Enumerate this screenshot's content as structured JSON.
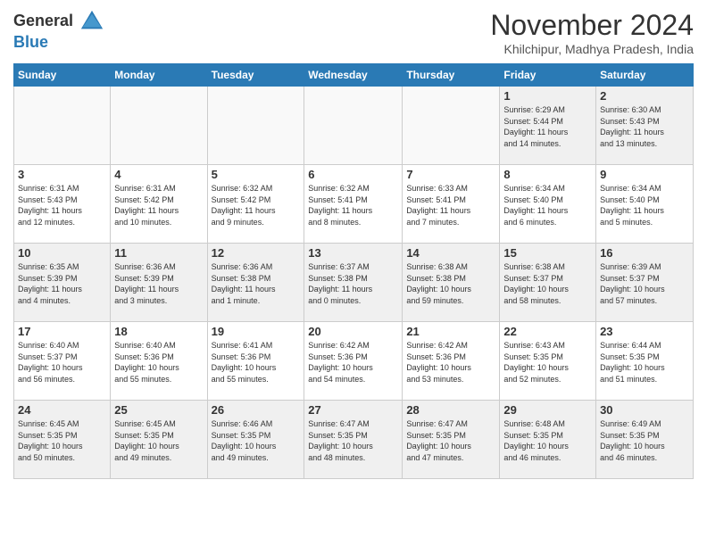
{
  "logo": {
    "general": "General",
    "blue": "Blue"
  },
  "header": {
    "month": "November 2024",
    "location": "Khilchipur, Madhya Pradesh, India"
  },
  "days_header": [
    "Sunday",
    "Monday",
    "Tuesday",
    "Wednesday",
    "Thursday",
    "Friday",
    "Saturday"
  ],
  "weeks": [
    [
      {
        "day": "",
        "info": ""
      },
      {
        "day": "",
        "info": ""
      },
      {
        "day": "",
        "info": ""
      },
      {
        "day": "",
        "info": ""
      },
      {
        "day": "",
        "info": ""
      },
      {
        "day": "1",
        "info": "Sunrise: 6:29 AM\nSunset: 5:44 PM\nDaylight: 11 hours\nand 14 minutes."
      },
      {
        "day": "2",
        "info": "Sunrise: 6:30 AM\nSunset: 5:43 PM\nDaylight: 11 hours\nand 13 minutes."
      }
    ],
    [
      {
        "day": "3",
        "info": "Sunrise: 6:31 AM\nSunset: 5:43 PM\nDaylight: 11 hours\nand 12 minutes."
      },
      {
        "day": "4",
        "info": "Sunrise: 6:31 AM\nSunset: 5:42 PM\nDaylight: 11 hours\nand 10 minutes."
      },
      {
        "day": "5",
        "info": "Sunrise: 6:32 AM\nSunset: 5:42 PM\nDaylight: 11 hours\nand 9 minutes."
      },
      {
        "day": "6",
        "info": "Sunrise: 6:32 AM\nSunset: 5:41 PM\nDaylight: 11 hours\nand 8 minutes."
      },
      {
        "day": "7",
        "info": "Sunrise: 6:33 AM\nSunset: 5:41 PM\nDaylight: 11 hours\nand 7 minutes."
      },
      {
        "day": "8",
        "info": "Sunrise: 6:34 AM\nSunset: 5:40 PM\nDaylight: 11 hours\nand 6 minutes."
      },
      {
        "day": "9",
        "info": "Sunrise: 6:34 AM\nSunset: 5:40 PM\nDaylight: 11 hours\nand 5 minutes."
      }
    ],
    [
      {
        "day": "10",
        "info": "Sunrise: 6:35 AM\nSunset: 5:39 PM\nDaylight: 11 hours\nand 4 minutes."
      },
      {
        "day": "11",
        "info": "Sunrise: 6:36 AM\nSunset: 5:39 PM\nDaylight: 11 hours\nand 3 minutes."
      },
      {
        "day": "12",
        "info": "Sunrise: 6:36 AM\nSunset: 5:38 PM\nDaylight: 11 hours\nand 1 minute."
      },
      {
        "day": "13",
        "info": "Sunrise: 6:37 AM\nSunset: 5:38 PM\nDaylight: 11 hours\nand 0 minutes."
      },
      {
        "day": "14",
        "info": "Sunrise: 6:38 AM\nSunset: 5:38 PM\nDaylight: 10 hours\nand 59 minutes."
      },
      {
        "day": "15",
        "info": "Sunrise: 6:38 AM\nSunset: 5:37 PM\nDaylight: 10 hours\nand 58 minutes."
      },
      {
        "day": "16",
        "info": "Sunrise: 6:39 AM\nSunset: 5:37 PM\nDaylight: 10 hours\nand 57 minutes."
      }
    ],
    [
      {
        "day": "17",
        "info": "Sunrise: 6:40 AM\nSunset: 5:37 PM\nDaylight: 10 hours\nand 56 minutes."
      },
      {
        "day": "18",
        "info": "Sunrise: 6:40 AM\nSunset: 5:36 PM\nDaylight: 10 hours\nand 55 minutes."
      },
      {
        "day": "19",
        "info": "Sunrise: 6:41 AM\nSunset: 5:36 PM\nDaylight: 10 hours\nand 55 minutes."
      },
      {
        "day": "20",
        "info": "Sunrise: 6:42 AM\nSunset: 5:36 PM\nDaylight: 10 hours\nand 54 minutes."
      },
      {
        "day": "21",
        "info": "Sunrise: 6:42 AM\nSunset: 5:36 PM\nDaylight: 10 hours\nand 53 minutes."
      },
      {
        "day": "22",
        "info": "Sunrise: 6:43 AM\nSunset: 5:35 PM\nDaylight: 10 hours\nand 52 minutes."
      },
      {
        "day": "23",
        "info": "Sunrise: 6:44 AM\nSunset: 5:35 PM\nDaylight: 10 hours\nand 51 minutes."
      }
    ],
    [
      {
        "day": "24",
        "info": "Sunrise: 6:45 AM\nSunset: 5:35 PM\nDaylight: 10 hours\nand 50 minutes."
      },
      {
        "day": "25",
        "info": "Sunrise: 6:45 AM\nSunset: 5:35 PM\nDaylight: 10 hours\nand 49 minutes."
      },
      {
        "day": "26",
        "info": "Sunrise: 6:46 AM\nSunset: 5:35 PM\nDaylight: 10 hours\nand 49 minutes."
      },
      {
        "day": "27",
        "info": "Sunrise: 6:47 AM\nSunset: 5:35 PM\nDaylight: 10 hours\nand 48 minutes."
      },
      {
        "day": "28",
        "info": "Sunrise: 6:47 AM\nSunset: 5:35 PM\nDaylight: 10 hours\nand 47 minutes."
      },
      {
        "day": "29",
        "info": "Sunrise: 6:48 AM\nSunset: 5:35 PM\nDaylight: 10 hours\nand 46 minutes."
      },
      {
        "day": "30",
        "info": "Sunrise: 6:49 AM\nSunset: 5:35 PM\nDaylight: 10 hours\nand 46 minutes."
      }
    ]
  ]
}
